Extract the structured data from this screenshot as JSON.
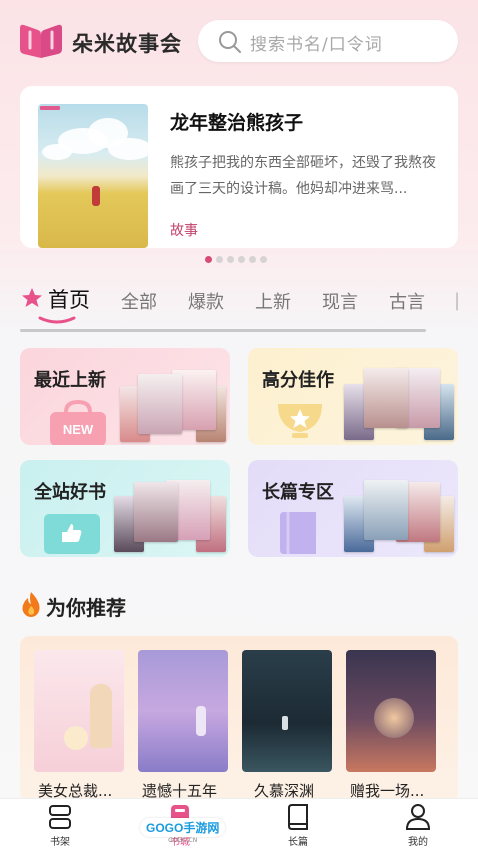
{
  "header": {
    "app_title": "朵米故事会",
    "search_placeholder": "搜索书名/口令词"
  },
  "banner": {
    "title": "龙年整治熊孩子",
    "description": "熊孩子把我的东西全部砸坏，还毁了我熬夜画了三天的设计稿。他妈却冲进来骂...",
    "tag": "故事",
    "dots": 6,
    "active_dot": 0
  },
  "tabs": [
    {
      "label": "首页",
      "active": true
    },
    {
      "label": "全部"
    },
    {
      "label": "爆款"
    },
    {
      "label": "上新"
    },
    {
      "label": "现言"
    },
    {
      "label": "古言"
    }
  ],
  "categories": [
    {
      "label": "最近上新",
      "badge": "NEW",
      "icon": "shopping-bag-icon",
      "color": "#f7a0b2"
    },
    {
      "label": "高分佳作",
      "icon": "trophy-icon",
      "color": "#f6d98a"
    },
    {
      "label": "全站好书",
      "icon": "thumbs-up-box-icon",
      "color": "#7fdbd8"
    },
    {
      "label": "长篇专区",
      "icon": "book-icon",
      "color": "#c2b1ef"
    }
  ],
  "recommend": {
    "title": "为你推荐",
    "books": [
      {
        "title": "美女总裁..."
      },
      {
        "title": "遗憾十五年"
      },
      {
        "title": "久慕深渊"
      },
      {
        "title": "赠我一场..."
      }
    ]
  },
  "bottom_nav": [
    {
      "label": "书架",
      "icon": "bookshelf-icon"
    },
    {
      "label": "书城",
      "icon": "bookstore-icon",
      "active": true
    },
    {
      "label": "长篇",
      "icon": "book-icon"
    },
    {
      "label": "我的",
      "icon": "user-icon"
    }
  ],
  "watermark": {
    "text": "GOGO手游网",
    "domain": "GOGO.CN"
  },
  "colors": {
    "accent": "#d84b76",
    "logo": "#e2467b"
  }
}
